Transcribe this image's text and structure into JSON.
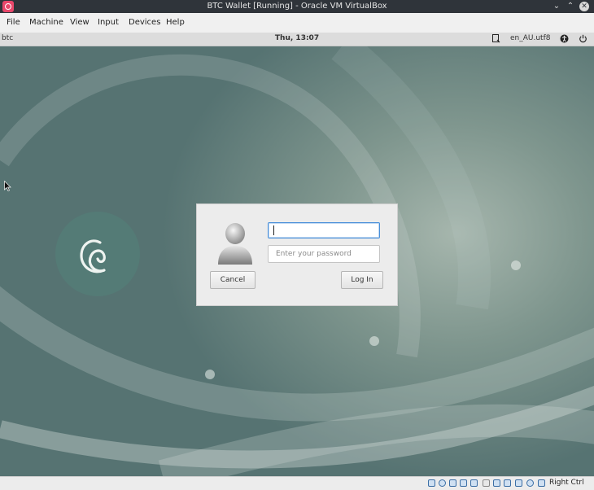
{
  "window": {
    "title": "BTC Wallet [Running] - Oracle VM VirtualBox",
    "icon": "virtualbox-app-icon",
    "controls": [
      "minimize-icon",
      "maximize-icon",
      "close-icon"
    ]
  },
  "menubar": {
    "items": [
      "File",
      "Machine",
      "View",
      "Input",
      "Devices",
      "Help"
    ]
  },
  "guest_panel": {
    "hostname": "btc",
    "clock": "Thu, 13:07",
    "locale": "en_AU.utf8",
    "icons": [
      "keyboard-layout-icon",
      "accessibility-icon",
      "power-icon"
    ]
  },
  "login": {
    "username_value": "",
    "password_placeholder": "Enter your password",
    "cancel_label": "Cancel",
    "login_label": "Log In",
    "avatar_icon": "user-avatar-icon"
  },
  "statusbar": {
    "host_key": "Right Ctrl",
    "icons": [
      "hard-disk-icon",
      "optical-drive-icon",
      "audio-icon",
      "network-icon",
      "usb-icon",
      "shared-folders-icon",
      "display-icon",
      "video-capture-icon",
      "guest-additions-icon",
      "cpu-icon",
      "mouse-integration-icon",
      "host-key-arrow-icon"
    ]
  },
  "colors": {
    "accent": "#4a90d9",
    "title_bar": "#2f343a",
    "debian_logo_bg": "#547b76"
  }
}
